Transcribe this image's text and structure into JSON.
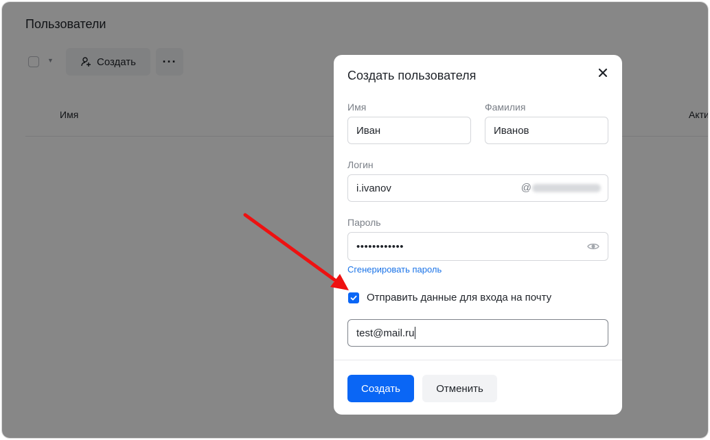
{
  "page": {
    "title": "Пользователи",
    "create_label": "Создать",
    "more_label": "···",
    "table": {
      "col_name": "Имя",
      "col_active": "Акти"
    }
  },
  "modal": {
    "title": "Создать пользователя",
    "first_name_label": "Имя",
    "first_name_value": "Иван",
    "last_name_label": "Фамилия",
    "last_name_value": "Иванов",
    "login_label": "Логин",
    "login_value": "i.ivanov",
    "login_domain_prefix": "@",
    "password_label": "Пароль",
    "password_masked": "••••••••••••",
    "generate_password_link": "Сгенерировать пароль",
    "send_credentials_label": "Отправить данные для входа на почту",
    "send_credentials_checked": true,
    "email_value": "test@mail.ru",
    "submit_label": "Создать",
    "cancel_label": "Отменить"
  },
  "colors": {
    "primary": "#0a66f5",
    "link": "#1a73e8",
    "annotation_arrow": "#ee1111"
  },
  "icons": {
    "create_user": "add-user-icon",
    "close": "close-icon",
    "password_visibility": "eye-icon",
    "checkbox": "checkmark-icon"
  }
}
